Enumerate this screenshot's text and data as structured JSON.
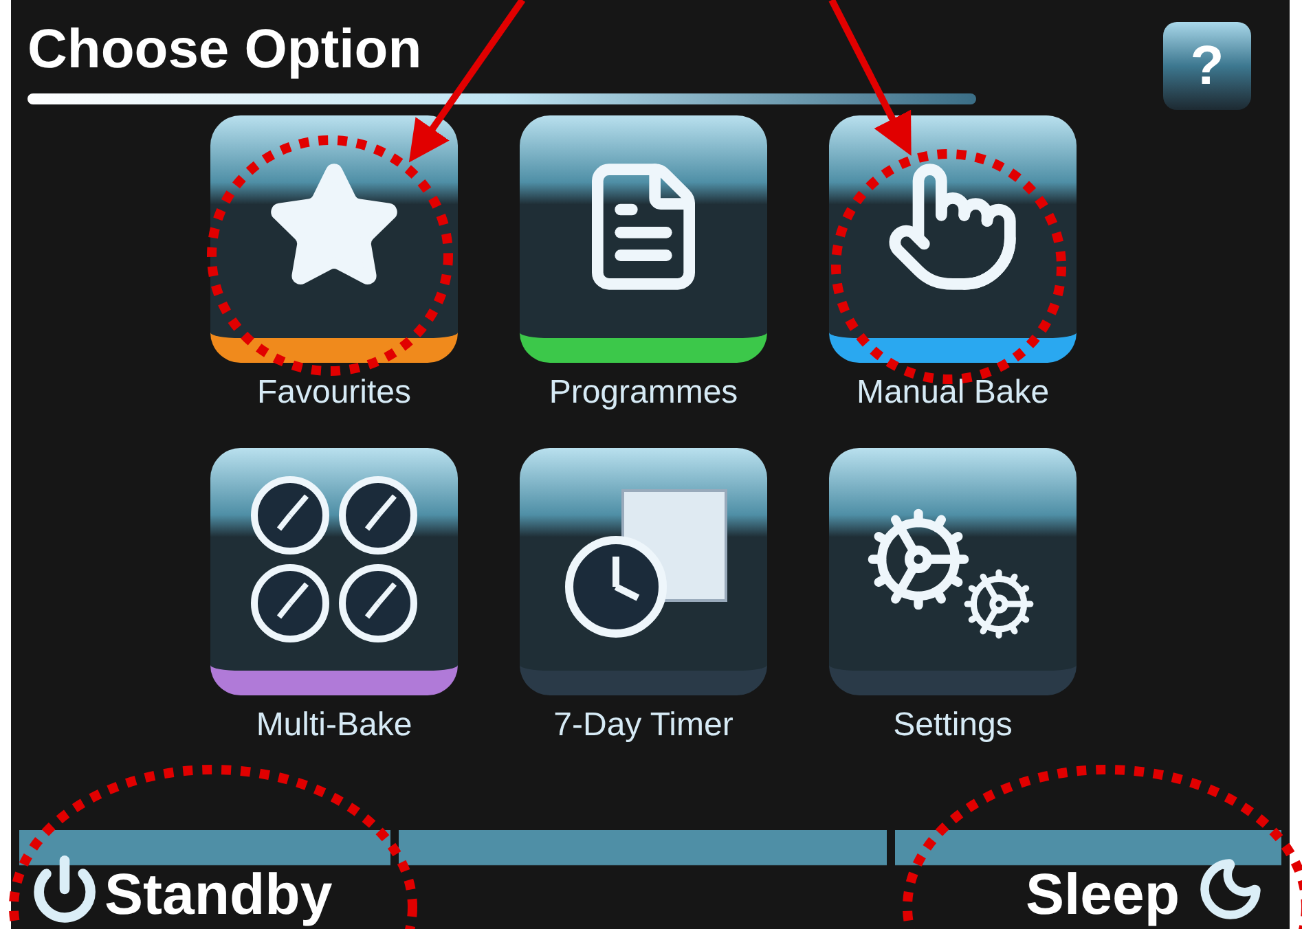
{
  "header": {
    "title": "Choose Option",
    "help": "?"
  },
  "tiles": [
    {
      "kind": "star",
      "label": "Favourites",
      "color": "#f08a1c"
    },
    {
      "kind": "document",
      "label": "Programmes",
      "color": "#3cc84a"
    },
    {
      "kind": "hand",
      "label": "Manual Bake",
      "color": "#2aa8f0"
    },
    {
      "kind": "clocks",
      "label": "Multi-Bake",
      "color": "#b07ad8"
    },
    {
      "kind": "timer",
      "label": "7-Day Timer",
      "color": "#2a3a48"
    },
    {
      "kind": "gears",
      "label": "Settings",
      "color": "#2a3a48"
    }
  ],
  "bottom_bar": {
    "standby": "Standby",
    "sleep": "Sleep"
  }
}
